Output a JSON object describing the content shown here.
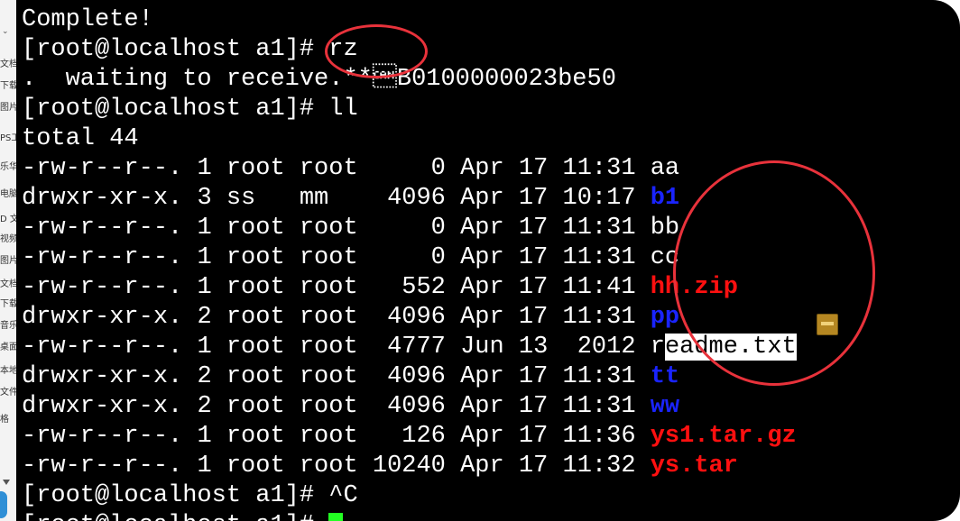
{
  "left_panel": {
    "items": [
      "文档",
      "下载",
      "图片",
      "PS工",
      "乐华",
      "电脑",
      "D 文",
      "视频",
      "图片",
      "文档",
      "下载",
      "音乐",
      "桌面",
      "本地",
      "文件",
      "格"
    ]
  },
  "terminal": {
    "lines": [
      {
        "text": "Complete!"
      },
      {
        "prompt": "[root@localhost a1]# ",
        "command": "rz"
      },
      {
        "text": ".  waiting to receive.**\u0018B0100000023be50"
      },
      {
        "prompt": "[root@localhost a1]# ",
        "command": "ll"
      },
      {
        "text": "total 44"
      }
    ],
    "listing": [
      {
        "perms": "-rw-r--r--.",
        "links": "1",
        "owner": "root",
        "group": "root",
        "size": "0",
        "month": "Apr",
        "day": "17",
        "time": "11:31",
        "name": "aa",
        "kind": "plain"
      },
      {
        "perms": "drwxr-xr-x.",
        "links": "3",
        "owner": "ss",
        "group": "mm",
        "size": "4096",
        "month": "Apr",
        "day": "17",
        "time": "10:17",
        "name": "b1",
        "kind": "dir"
      },
      {
        "perms": "-rw-r--r--.",
        "links": "1",
        "owner": "root",
        "group": "root",
        "size": "0",
        "month": "Apr",
        "day": "17",
        "time": "11:31",
        "name": "bb",
        "kind": "plain"
      },
      {
        "perms": "-rw-r--r--.",
        "links": "1",
        "owner": "root",
        "group": "root",
        "size": "0",
        "month": "Apr",
        "day": "17",
        "time": "11:31",
        "name": "cc",
        "kind": "plain"
      },
      {
        "perms": "-rw-r--r--.",
        "links": "1",
        "owner": "root",
        "group": "root",
        "size": "552",
        "month": "Apr",
        "day": "17",
        "time": "11:41",
        "name": "hh.zip",
        "kind": "archive"
      },
      {
        "perms": "drwxr-xr-x.",
        "links": "2",
        "owner": "root",
        "group": "root",
        "size": "4096",
        "month": "Apr",
        "day": "17",
        "time": "11:31",
        "name": "pp",
        "kind": "dir"
      },
      {
        "perms": "-rw-r--r--.",
        "links": "1",
        "owner": "root",
        "group": "root",
        "size": "4777",
        "month": "Jun",
        "day": "13",
        "time": " 2012",
        "name": "readme.txt",
        "kind": "selected"
      },
      {
        "perms": "drwxr-xr-x.",
        "links": "2",
        "owner": "root",
        "group": "root",
        "size": "4096",
        "month": "Apr",
        "day": "17",
        "time": "11:31",
        "name": "tt",
        "kind": "dir"
      },
      {
        "perms": "drwxr-xr-x.",
        "links": "2",
        "owner": "root",
        "group": "root",
        "size": "4096",
        "month": "Apr",
        "day": "17",
        "time": "11:31",
        "name": "ww",
        "kind": "dir"
      },
      {
        "perms": "-rw-r--r--.",
        "links": "1",
        "owner": "root",
        "group": "root",
        "size": "126",
        "month": "Apr",
        "day": "17",
        "time": "11:36",
        "name": "ys1.tar.gz",
        "kind": "archive"
      },
      {
        "perms": "-rw-r--r--.",
        "links": "1",
        "owner": "root",
        "group": "root",
        "size": "10240",
        "month": "Apr",
        "day": "17",
        "time": "11:32",
        "name": "ys.tar",
        "kind": "archive"
      }
    ],
    "after": [
      {
        "prompt": "[root@localhost a1]# ",
        "command": "^C"
      },
      {
        "prompt": "[root@localhost a1]# ",
        "command": ""
      }
    ]
  },
  "colors": {
    "background": "#000000",
    "foreground": "#ffffff",
    "directory": "#1a24ff",
    "archive": "#ff1010",
    "cursor": "#22ff22",
    "annotation": "#e8323b"
  }
}
